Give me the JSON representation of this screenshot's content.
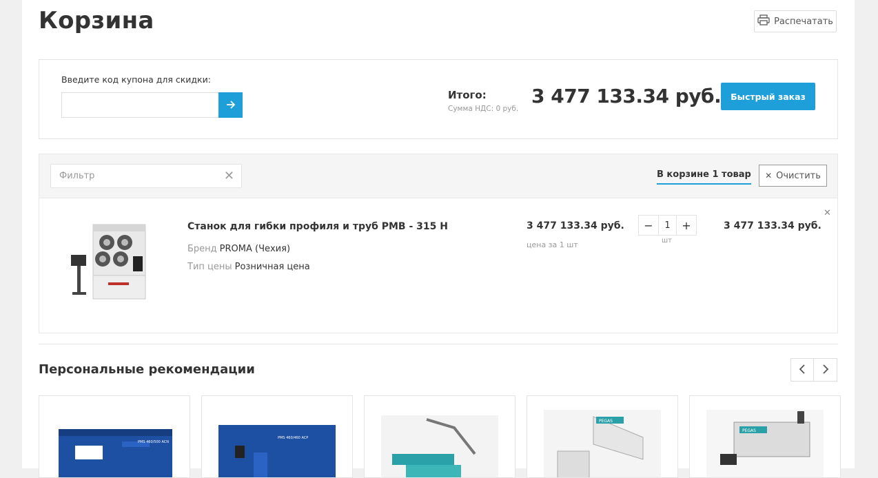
{
  "header": {
    "title": "Корзина",
    "print_label": "Распечатать"
  },
  "coupon": {
    "label": "Введите код купона для скидки:",
    "placeholder": ""
  },
  "totals": {
    "total_label": "Итого:",
    "vat_label": "Сумма НДС: 0 руб.",
    "total_value": "3 477 133.34 руб.",
    "quick_order_label": "Быстрый заказ"
  },
  "toolbar": {
    "filter_placeholder": "Фильтр",
    "cart_count_label": "В корзине 1 товар",
    "clear_label": "Очистить"
  },
  "items": [
    {
      "name": "Станок для гибки профиля и труб PMB - 315 H",
      "props": [
        {
          "label": "Бренд",
          "value": "PROMA (Чехия)"
        },
        {
          "label": "Тип цены",
          "value": "Розничная цена"
        }
      ],
      "unit_price": "3 477 133.34 руб.",
      "unit_price_note": "цена за 1 шт",
      "quantity": "1",
      "quantity_unit": "шт",
      "line_total": "3 477 133.34 руб."
    }
  ],
  "recommendations": {
    "title": "Персональные рекомендации",
    "cards": [
      {
        "caption": "PMS 460/500 ACN"
      },
      {
        "caption": "PMS 460/460 ACP"
      },
      {
        "caption": ""
      },
      {
        "caption": "PEGAS"
      },
      {
        "caption": "PEGAS"
      }
    ]
  },
  "colors": {
    "accent": "#1e9fd9",
    "text": "#333333",
    "muted": "#999999",
    "machine_blue": "#1d4fa3"
  }
}
